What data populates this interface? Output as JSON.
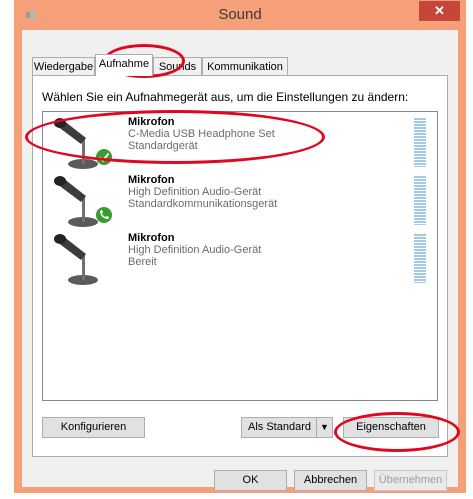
{
  "window": {
    "title": "Sound",
    "close_glyph": "✕"
  },
  "tabs": [
    {
      "label": "Wiedergabe"
    },
    {
      "label": "Aufnahme"
    },
    {
      "label": "Sounds"
    },
    {
      "label": "Kommunikation"
    }
  ],
  "instruction": "Wählen Sie ein Aufnahmegerät aus, um die Einstellungen zu ändern:",
  "devices": [
    {
      "name": "Mikrofon",
      "line1": "C-Media USB Headphone Set",
      "line2": "Standardgerät",
      "status_icon": "check-icon"
    },
    {
      "name": "Mikrofon",
      "line1": "High Definition Audio-Gerät",
      "line2": "Standardkommunikationsgerät",
      "status_icon": "phone-icon"
    },
    {
      "name": "Mikrofon",
      "line1": "High Definition Audio-Gerät",
      "line2": "Bereit",
      "status_icon": ""
    }
  ],
  "buttons": {
    "configure": "Konfigurieren",
    "set_default": "Als Standard",
    "properties": "Eigenschaften",
    "ok": "OK",
    "cancel": "Abbrechen",
    "apply": "Übernehmen"
  },
  "colors": {
    "titlebar": "#f5a078",
    "close": "#c7463a",
    "status_green": "#3a9b2f",
    "level_meter": "#a5c9ea",
    "annotation": "#e0081e"
  }
}
